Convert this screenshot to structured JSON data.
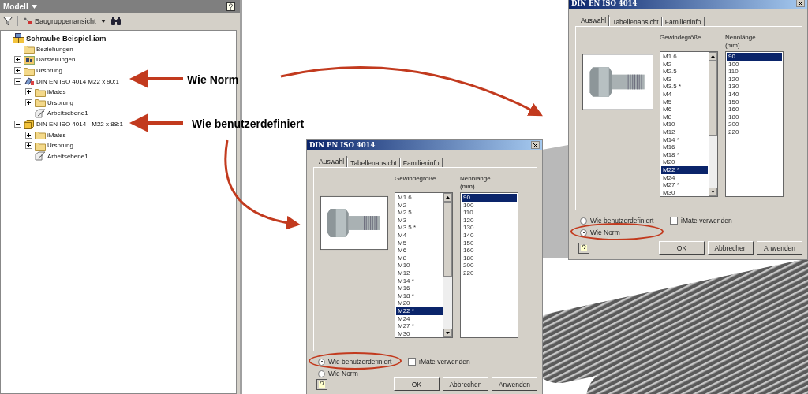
{
  "model_panel": {
    "title": "Modell",
    "view_label": "Baugruppenansicht",
    "tree": {
      "label": "Schraube Beispiel.iam",
      "kind": "assembly",
      "children": [
        {
          "label": "Beziehungen",
          "kind": "folder"
        },
        {
          "label": "Darstellungen",
          "kind": "representations",
          "expanded": false
        },
        {
          "label": "Ursprung",
          "kind": "folder",
          "expanded": false
        },
        {
          "label": "DIN EN ISO 4014 M22 x 90:1",
          "kind": "part-standard",
          "expanded": true,
          "children": [
            {
              "label": "iMates",
              "kind": "folder",
              "expanded": false
            },
            {
              "label": "Ursprung",
              "kind": "folder",
              "expanded": false
            },
            {
              "label": "Arbeitsebene1",
              "kind": "workplane"
            }
          ]
        },
        {
          "label": "DIN EN ISO 4014 - M22 x 88:1",
          "kind": "part-custom",
          "expanded": true,
          "children": [
            {
              "label": "iMates",
              "kind": "folder",
              "expanded": false
            },
            {
              "label": "Ursprung",
              "kind": "folder",
              "expanded": false
            },
            {
              "label": "Arbeitsebene1",
              "kind": "workplane"
            }
          ]
        }
      ]
    }
  },
  "annotations": [
    {
      "text": "Wie Norm"
    },
    {
      "text": "Wie benutzerdefiniert"
    }
  ],
  "dialogs": [
    {
      "title": "DIN EN ISO 4014",
      "tabs": [
        {
          "label": "Auswahl",
          "selected": true
        },
        {
          "label": "Tabellenansicht",
          "selected": false
        },
        {
          "label": "Familieninfo",
          "selected": false
        }
      ],
      "size_header": "Gewindegröße",
      "length_header": "Nennlänge\n(mm)",
      "sizes": [
        {
          "label": "M1.6",
          "selected": false
        },
        {
          "label": "M2",
          "selected": false
        },
        {
          "label": "M2.5",
          "selected": false
        },
        {
          "label": "M3",
          "selected": false
        },
        {
          "label": "M3.5 *",
          "selected": false
        },
        {
          "label": "M4",
          "selected": false
        },
        {
          "label": "M5",
          "selected": false
        },
        {
          "label": "M6",
          "selected": false
        },
        {
          "label": "M8",
          "selected": false
        },
        {
          "label": "M10",
          "selected": false
        },
        {
          "label": "M12",
          "selected": false
        },
        {
          "label": "M14 *",
          "selected": false
        },
        {
          "label": "M16",
          "selected": false
        },
        {
          "label": "M18 *",
          "selected": false
        },
        {
          "label": "M20",
          "selected": false
        },
        {
          "label": "M22 *",
          "selected": true
        },
        {
          "label": "M24",
          "selected": false
        },
        {
          "label": "M27 *",
          "selected": false
        },
        {
          "label": "M30",
          "selected": false
        }
      ],
      "lengths": [
        {
          "label": "90",
          "selected": true
        },
        {
          "label": "100",
          "selected": false
        },
        {
          "label": "110",
          "selected": false
        },
        {
          "label": "120",
          "selected": false
        },
        {
          "label": "130",
          "selected": false
        },
        {
          "label": "140",
          "selected": false
        },
        {
          "label": "150",
          "selected": false
        },
        {
          "label": "160",
          "selected": false
        },
        {
          "label": "180",
          "selected": false
        },
        {
          "label": "200",
          "selected": false
        },
        {
          "label": "220",
          "selected": false
        }
      ],
      "options": [
        {
          "label": "Wie benutzerdefiniert",
          "selected": true
        },
        {
          "label": "Wie Norm",
          "selected": false
        }
      ],
      "imate": {
        "label": "iMate verwenden",
        "checked": false
      },
      "buttons": [
        "OK",
        "Abbrechen",
        "Anwenden"
      ]
    },
    {
      "title": "DIN EN ISO 4014",
      "tabs": [
        {
          "label": "Auswahl",
          "selected": true
        },
        {
          "label": "Tabellenansicht",
          "selected": false
        },
        {
          "label": "Familieninfo",
          "selected": false
        }
      ],
      "size_header": "Gewindegröße",
      "length_header": "Nennlänge\n(mm)",
      "sizes": [
        {
          "label": "M1.6",
          "selected": false
        },
        {
          "label": "M2",
          "selected": false
        },
        {
          "label": "M2.5",
          "selected": false
        },
        {
          "label": "M3",
          "selected": false
        },
        {
          "label": "M3.5 *",
          "selected": false
        },
        {
          "label": "M4",
          "selected": false
        },
        {
          "label": "M5",
          "selected": false
        },
        {
          "label": "M6",
          "selected": false
        },
        {
          "label": "M8",
          "selected": false
        },
        {
          "label": "M10",
          "selected": false
        },
        {
          "label": "M12",
          "selected": false
        },
        {
          "label": "M14 *",
          "selected": false
        },
        {
          "label": "M16",
          "selected": false
        },
        {
          "label": "M18 *",
          "selected": false
        },
        {
          "label": "M20",
          "selected": false
        },
        {
          "label": "M22 *",
          "selected": true
        },
        {
          "label": "M24",
          "selected": false
        },
        {
          "label": "M27 *",
          "selected": false
        },
        {
          "label": "M30",
          "selected": false
        }
      ],
      "lengths": [
        {
          "label": "90",
          "selected": true
        },
        {
          "label": "100",
          "selected": false
        },
        {
          "label": "110",
          "selected": false
        },
        {
          "label": "120",
          "selected": false
        },
        {
          "label": "130",
          "selected": false
        },
        {
          "label": "140",
          "selected": false
        },
        {
          "label": "150",
          "selected": false
        },
        {
          "label": "160",
          "selected": false
        },
        {
          "label": "180",
          "selected": false
        },
        {
          "label": "200",
          "selected": false
        },
        {
          "label": "220",
          "selected": false
        }
      ],
      "options": [
        {
          "label": "Wie benutzerdefiniert",
          "selected": false
        },
        {
          "label": "Wie Norm",
          "selected": true
        }
      ],
      "imate": {
        "label": "iMate verwenden",
        "checked": false
      },
      "buttons": [
        "OK",
        "Abbrechen",
        "Anwenden"
      ]
    }
  ]
}
